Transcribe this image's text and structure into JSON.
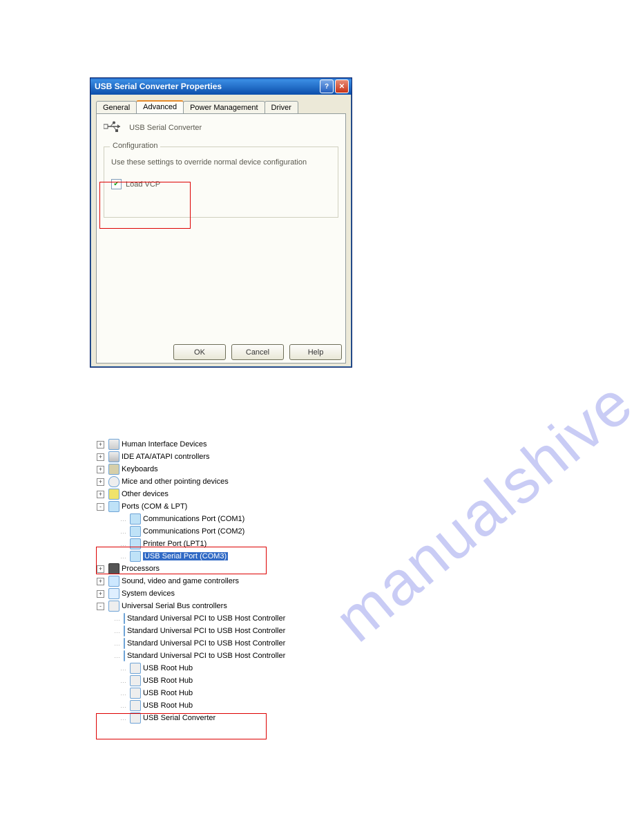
{
  "dialog": {
    "title": "USB Serial Converter Properties",
    "tabs": [
      "General",
      "Advanced",
      "Power Management",
      "Driver"
    ],
    "active_tab": "Advanced",
    "device_label": "USB Serial Converter",
    "fieldset_legend": "Configuration",
    "fieldset_desc": "Use these settings to override normal device configuration",
    "checkbox_label": "Load VCP",
    "buttons": {
      "ok": "OK",
      "cancel": "Cancel",
      "help": "Help"
    }
  },
  "tree": {
    "nodes": [
      {
        "pm": "+",
        "depth": 1,
        "icon": "i-hid",
        "label": "Human Interface Devices"
      },
      {
        "pm": "+",
        "depth": 1,
        "icon": "i-ide",
        "label": "IDE ATA/ATAPI controllers"
      },
      {
        "pm": "+",
        "depth": 1,
        "icon": "i-kb",
        "label": "Keyboards"
      },
      {
        "pm": "+",
        "depth": 1,
        "icon": "i-mouse",
        "label": "Mice and other pointing devices"
      },
      {
        "pm": "+",
        "depth": 1,
        "icon": "i-other",
        "label": "Other devices"
      },
      {
        "pm": "-",
        "depth": 1,
        "icon": "i-port",
        "label": "Ports (COM & LPT)"
      },
      {
        "pm": "",
        "depth": 2,
        "icon": "i-port",
        "label": "Communications Port (COM1)"
      },
      {
        "pm": "",
        "depth": 2,
        "icon": "i-port",
        "label": "Communications Port (COM2)"
      },
      {
        "pm": "",
        "depth": 2,
        "icon": "i-port",
        "label": "Printer Port (LPT1)"
      },
      {
        "pm": "",
        "depth": 2,
        "icon": "i-port",
        "label": "USB Serial Port (COM3)",
        "selected": true
      },
      {
        "pm": "+",
        "depth": 1,
        "icon": "i-proc",
        "label": "Processors"
      },
      {
        "pm": "+",
        "depth": 1,
        "icon": "i-sound",
        "label": "Sound, video and game controllers"
      },
      {
        "pm": "+",
        "depth": 1,
        "icon": "i-sys",
        "label": "System devices"
      },
      {
        "pm": "-",
        "depth": 1,
        "icon": "i-usb",
        "label": "Universal Serial Bus controllers"
      },
      {
        "pm": "",
        "depth": 2,
        "icon": "i-usbc",
        "label": "Standard Universal PCI to USB Host Controller"
      },
      {
        "pm": "",
        "depth": 2,
        "icon": "i-usbc",
        "label": "Standard Universal PCI to USB Host Controller"
      },
      {
        "pm": "",
        "depth": 2,
        "icon": "i-usbc",
        "label": "Standard Universal PCI to USB Host Controller"
      },
      {
        "pm": "",
        "depth": 2,
        "icon": "i-usbc",
        "label": "Standard Universal PCI to USB Host Controller"
      },
      {
        "pm": "",
        "depth": 2,
        "icon": "i-usbc",
        "label": "USB Root Hub"
      },
      {
        "pm": "",
        "depth": 2,
        "icon": "i-usbc",
        "label": "USB Root Hub"
      },
      {
        "pm": "",
        "depth": 2,
        "icon": "i-usbc",
        "label": "USB Root Hub"
      },
      {
        "pm": "",
        "depth": 2,
        "icon": "i-usbc",
        "label": "USB Root Hub"
      },
      {
        "pm": "",
        "depth": 2,
        "icon": "i-usbc",
        "label": "USB Serial Converter"
      }
    ]
  },
  "watermark": "manualshive.com"
}
